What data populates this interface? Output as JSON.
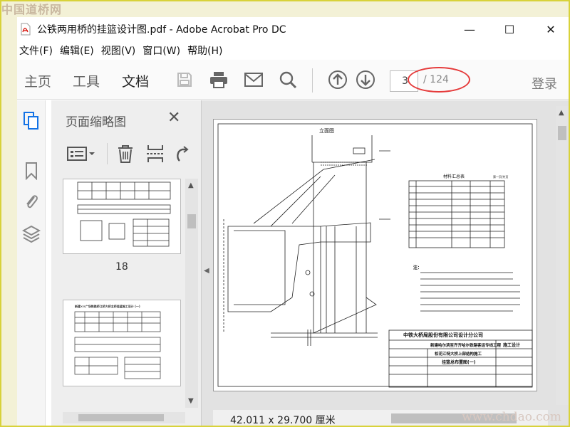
{
  "watermark_top": "中国道桥网",
  "watermark_bottom": "www.chdao.com",
  "window": {
    "title": "公铁两用桥的挂篮设计图.pdf - Adobe Acrobat Pro DC",
    "controls": [
      "—",
      "☐",
      "✕"
    ]
  },
  "menu": [
    "文件(F)",
    "编辑(E)",
    "视图(V)",
    "窗口(W)",
    "帮助(H)"
  ],
  "toolbar": {
    "tabs": [
      "主页",
      "工具",
      "文档"
    ],
    "active_tab": "文档",
    "icons": [
      "save-icon",
      "print-icon",
      "email-icon",
      "search-icon",
      "page-up-icon",
      "page-down-icon"
    ],
    "current_page": "3",
    "page_total": "/ 124",
    "login": "登录",
    "highlight_color": "#e53a3a"
  },
  "thumbnails": {
    "title": "页面缩略图",
    "close": "✕",
    "pages": [
      {
        "label": "18"
      },
      {
        "label": "",
        "heading": "新建××广场铁路桥江桥大桥主桥挂篮施工设计 (一)"
      }
    ]
  },
  "document": {
    "status": "42.011 x 29.700 厘米",
    "drawing": {
      "top_label": "立面图",
      "table_title": "材料汇总表",
      "table_note": "第一页/共页",
      "table_rows": 10,
      "notes_title": "注：",
      "company": "中铁大桥局股份有限公司设计分公司",
      "project": "新建哈尔滨至齐齐哈尔铁路客运专线工程",
      "bridge": "松花江特大桥上部结构施工",
      "sheet": "挂篮总布置图(一)",
      "stamp": "施工设计"
    }
  }
}
